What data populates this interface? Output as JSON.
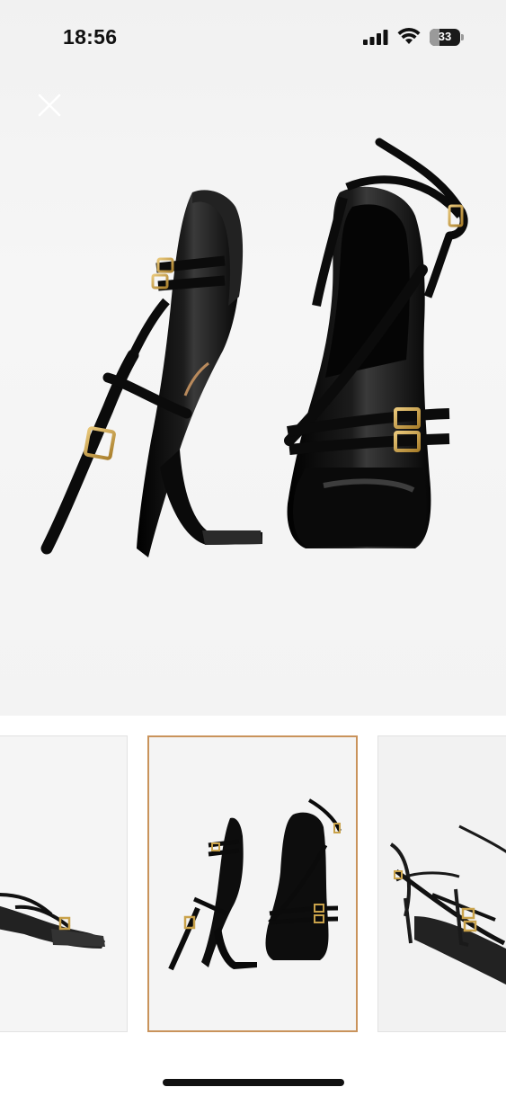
{
  "status_bar": {
    "time": "18:56",
    "battery_level": "33",
    "icons": [
      "signal-icon",
      "wifi-icon",
      "battery-icon"
    ]
  },
  "viewer": {
    "close_icon": "close-icon",
    "main_image": "black-patent-strappy-heeled-sandals-pair",
    "thumbnails": [
      {
        "image": "sandal-side-view",
        "selected": false
      },
      {
        "image": "sandal-pair-top-view",
        "selected": true
      },
      {
        "image": "sandal-angled-view",
        "selected": false
      }
    ],
    "selected_index": 1
  },
  "colors": {
    "selected_border": "#c9935b",
    "shoe": "#0d0d0d",
    "buckle": "#c9a24a",
    "background": "#f3f3f3"
  }
}
